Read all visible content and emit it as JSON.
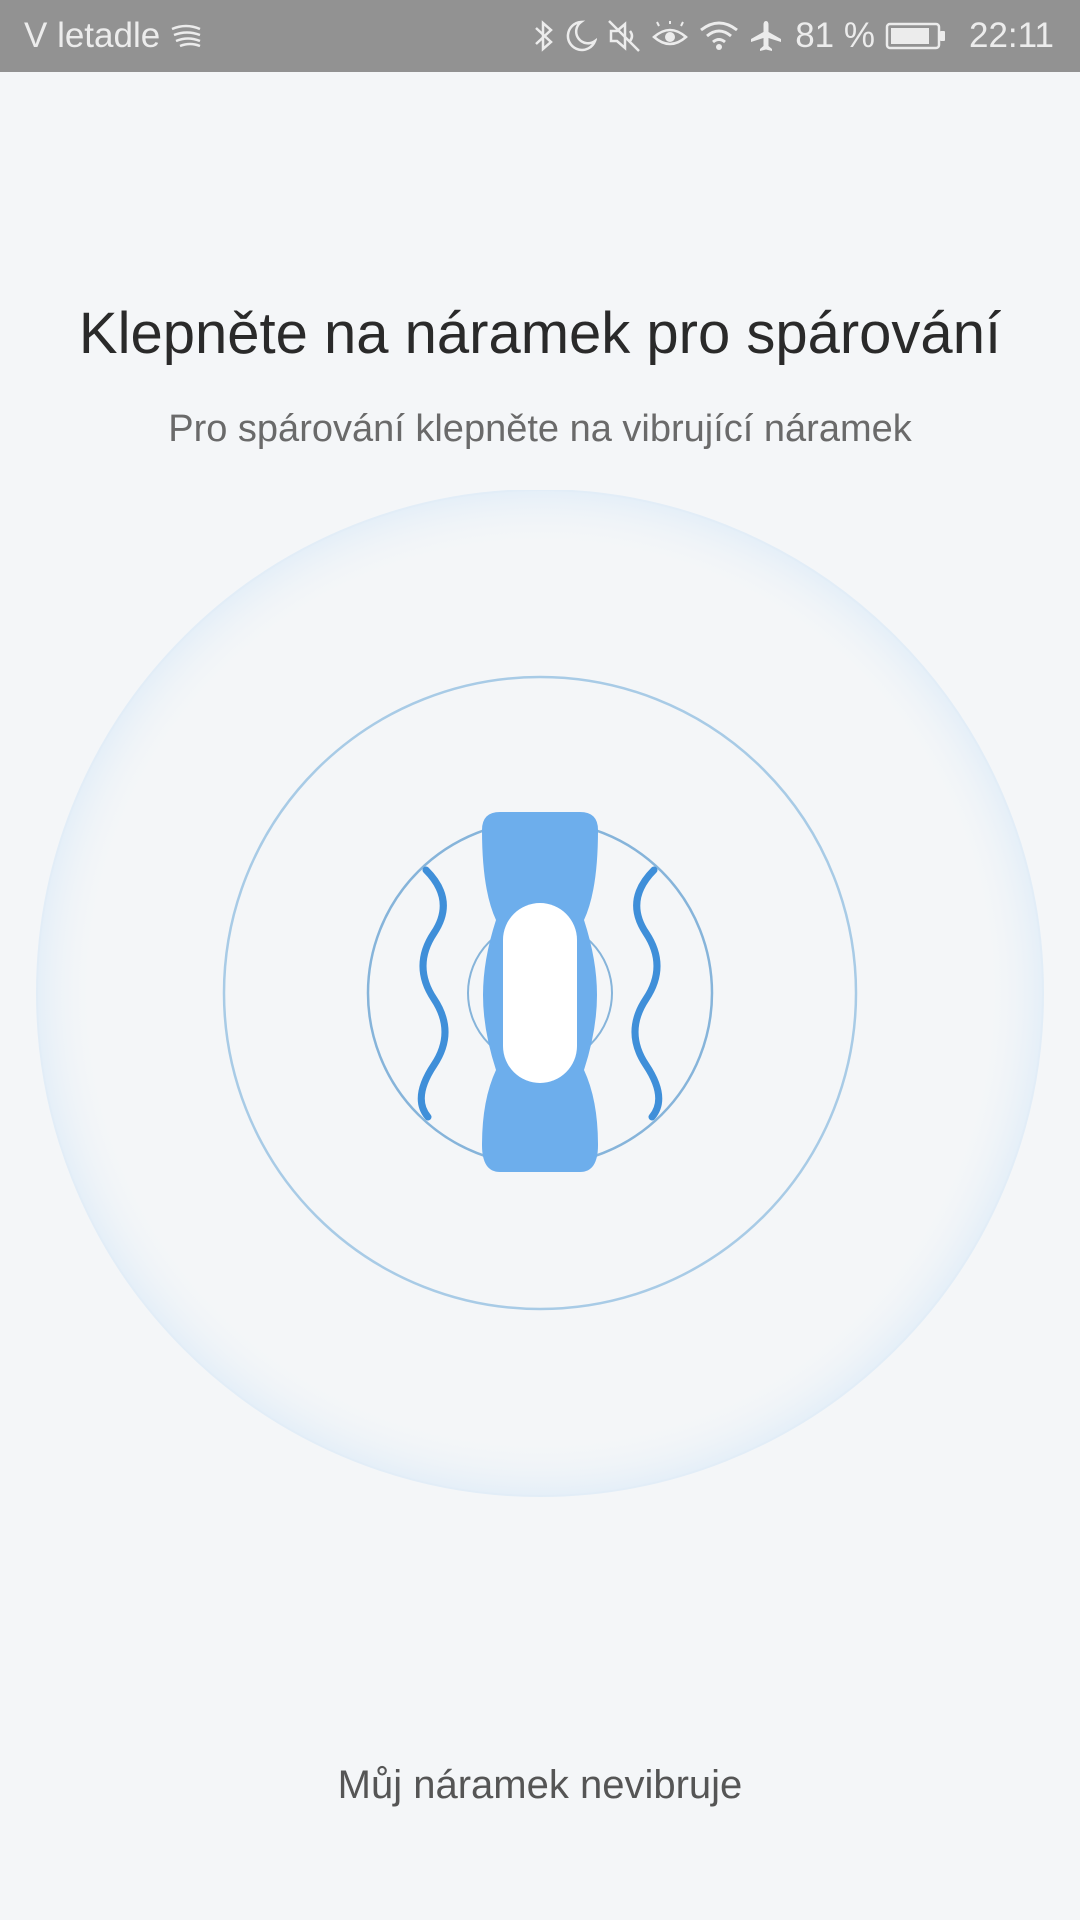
{
  "status_bar": {
    "carrier": "V letadle",
    "battery_percent": "81 %",
    "time": "22:11",
    "icons": [
      "swiftkey-icon",
      "bluetooth-icon",
      "moon-icon",
      "mute-icon",
      "eye-icon",
      "wifi-icon",
      "airplane-icon",
      "battery-icon"
    ]
  },
  "pairing": {
    "title": "Klepněte na náramek pro spárování",
    "subtitle": "Pro spárování klepněte na vibrující náramek",
    "not_vibrating_link": "Můj náramek nevibruje"
  },
  "colors": {
    "band": "#6daeec",
    "waves": "#3f8fd9",
    "rings": "#a8cbe6",
    "background": "#f4f6f8"
  }
}
